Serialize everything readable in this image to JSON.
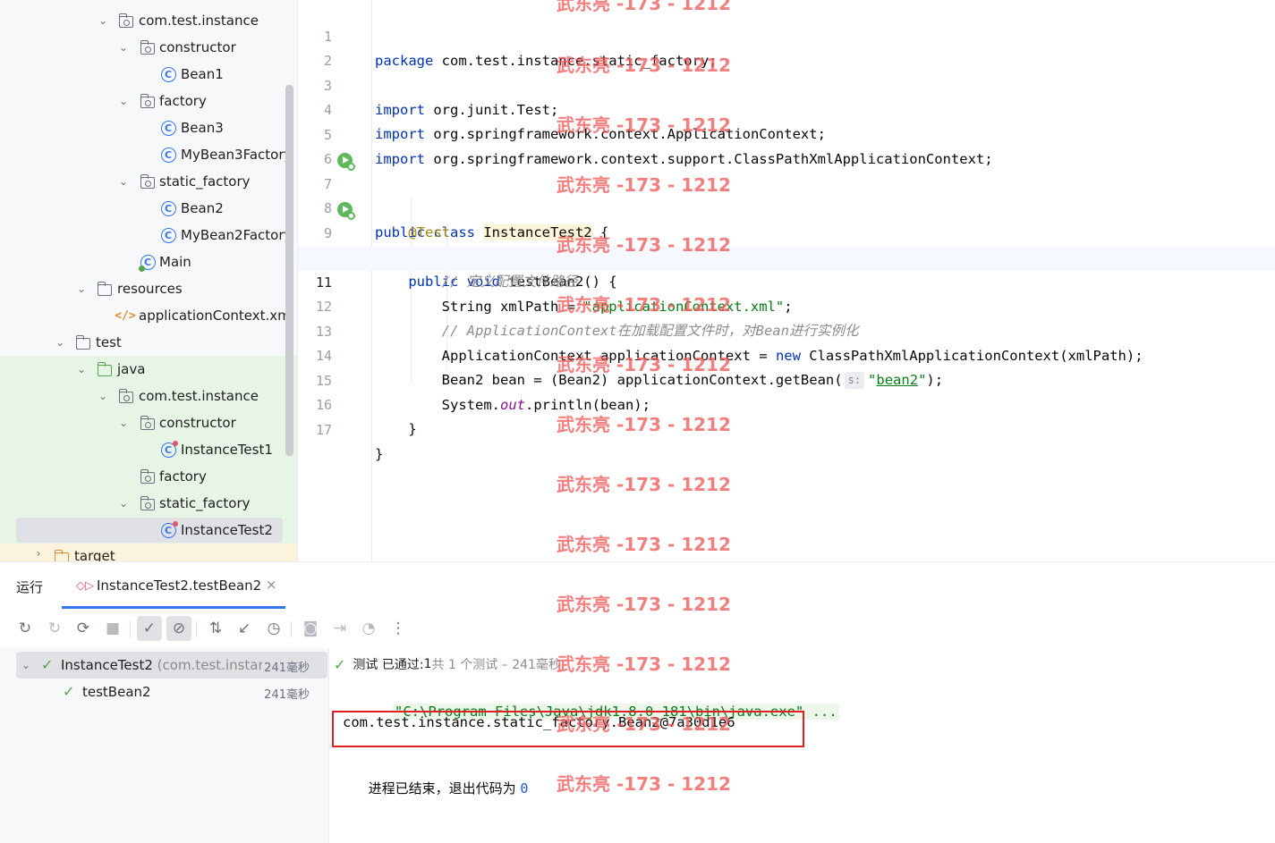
{
  "project_tree": {
    "rows": [
      {
        "label": "com.test.instance"
      },
      {
        "label": "constructor"
      },
      {
        "label": "Bean1"
      },
      {
        "label": "factory"
      },
      {
        "label": "Bean3"
      },
      {
        "label": "MyBean3Factory"
      },
      {
        "label": "static_factory"
      },
      {
        "label": "Bean2"
      },
      {
        "label": "MyBean2Factory"
      },
      {
        "label": "Main"
      },
      {
        "label": "resources"
      },
      {
        "label": "applicationContext.xml"
      },
      {
        "label": "test"
      },
      {
        "label": "java"
      },
      {
        "label": "com.test.instance"
      },
      {
        "label": "constructor"
      },
      {
        "label": "InstanceTest1"
      },
      {
        "label": "factory"
      },
      {
        "label": "static_factory"
      },
      {
        "label": "InstanceTest2"
      },
      {
        "label": "target"
      }
    ]
  },
  "editor": {
    "line_numbers": [
      "1",
      "2",
      "3",
      "4",
      "5",
      "6",
      "7",
      "8",
      "9",
      "10",
      "11",
      "12",
      "13",
      "14",
      "15",
      "16",
      "17"
    ],
    "current_line": "11",
    "code": {
      "l1_kw": "package",
      "l1_rest": " com.test.instance.static_factory;",
      "l3_kw": "import",
      "l3_rest": " org.junit.Test;",
      "l4_kw": "import",
      "l4_rest": " org.springframework.context.ApplicationContext;",
      "l5_kw": "import",
      "l5_rest": " org.springframework.context.support.ClassPathXmlApplicationContext;",
      "l7_kw": "public class",
      "l7_cls": "InstanceTest2",
      "l7_rest": " {",
      "l8_ann": "@Test",
      "l9_kw": "public void",
      "l9_rest": " testBean2() {",
      "l10_cmt": "// 定义配置文件路径",
      "l11_a": "String xmlPath = ",
      "l11_str": "\"applicationContext.xml\"",
      "l11_b": ";",
      "l12_cmt": "// ApplicationContext在加载配置文件时，对Bean进行实例化",
      "l13_a": "ApplicationContext applicationContext = ",
      "l13_kw": "new",
      "l13_b": " ClassPathXmlApplicationContext(xmlPath);",
      "l14_a": "Bean2 bean = (Bean2) applicationContext.getBean(",
      "l14_hint": "s:",
      "l14_q1": "\"",
      "l14_link": "bean2",
      "l14_q2": "\"",
      "l14_b": ");",
      "l15_a": "System.",
      "l15_field": "out",
      "l15_b": ".println(bean);",
      "l16": "}",
      "l17": "}"
    }
  },
  "run_panel": {
    "title": "运行",
    "tab_label": "InstanceTest2.testBean2",
    "tab_close": "×",
    "toolbar_icons": [
      "rerun-icon",
      "rerun-failed-icon",
      "toggle-auto-test-icon",
      "stop-icon",
      "show-passed-icon",
      "show-ignored-icon",
      "sort-icon",
      "collapse-icon",
      "history-icon",
      "screenshot-icon",
      "export-icon",
      "dashboard-icon",
      "more-icon"
    ],
    "test_tree": {
      "root_label": "InstanceTest2",
      "root_package": "(com.test.instanc",
      "root_time": "241毫秒",
      "child_label": "testBean2",
      "child_time": "241毫秒"
    },
    "console": {
      "status_prefix": "测试 已通过: ",
      "status_count": "1",
      "status_suffix": "共 1 个测试 – 241毫秒",
      "cmd_line": "\"C:\\Program Files\\Java\\jdk1.8.0_181\\bin\\java.exe\" ...",
      "output_line": "com.test.instance.static_factory.Bean2@7a30d1e6",
      "exit_text": "进程已结束，退出代码为 ",
      "exit_code": "0"
    }
  },
  "watermark": {
    "text": "武东亮 -173 - 1212"
  }
}
